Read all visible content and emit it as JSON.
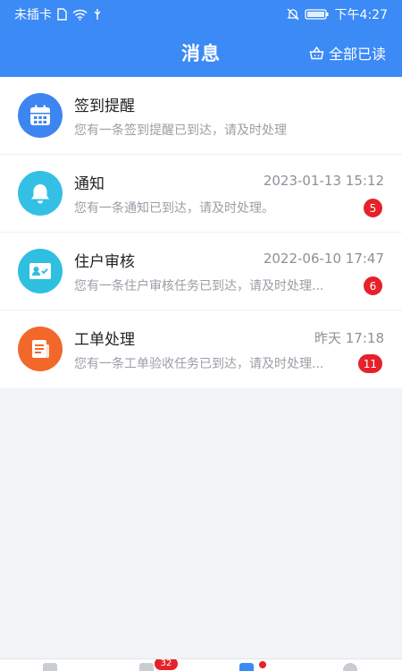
{
  "status_bar": {
    "carrier": "未插卡",
    "time": "下午4:27",
    "icons": [
      "sim-card-icon",
      "wifi-icon",
      "usb-icon",
      "bell-off-icon",
      "battery-icon"
    ]
  },
  "header": {
    "title": "消息",
    "mark_all_label": "全部已读",
    "mark_all_icon": "basket-icon"
  },
  "messages": [
    {
      "title": "签到提醒",
      "subtitle": "您有一条签到提醒已到达，请及时处理",
      "time": "",
      "badge": "",
      "icon": "calendar-icon",
      "color": "#3d85f0"
    },
    {
      "title": "通知",
      "subtitle": "您有一条通知已到达，请及时处理。",
      "time": "2023-01-13 15:12",
      "badge": "5",
      "icon": "bell-icon",
      "color": "#33c0e4"
    },
    {
      "title": "住户审核",
      "subtitle": "您有一条住户审核任务已到达，请及时处理...",
      "time": "2022-06-10 17:47",
      "badge": "6",
      "icon": "id-card-icon",
      "color": "#2fbfe1"
    },
    {
      "title": "工单处理",
      "subtitle": "您有一条工单验收任务已到达，请及时处理...",
      "time": "昨天 17:18",
      "badge": "11",
      "icon": "document-icon",
      "color": "#f2682a"
    }
  ],
  "tab_bar": {
    "badge": "32"
  },
  "colors": {
    "primary": "#3b8af5",
    "badge": "#e5222b"
  }
}
